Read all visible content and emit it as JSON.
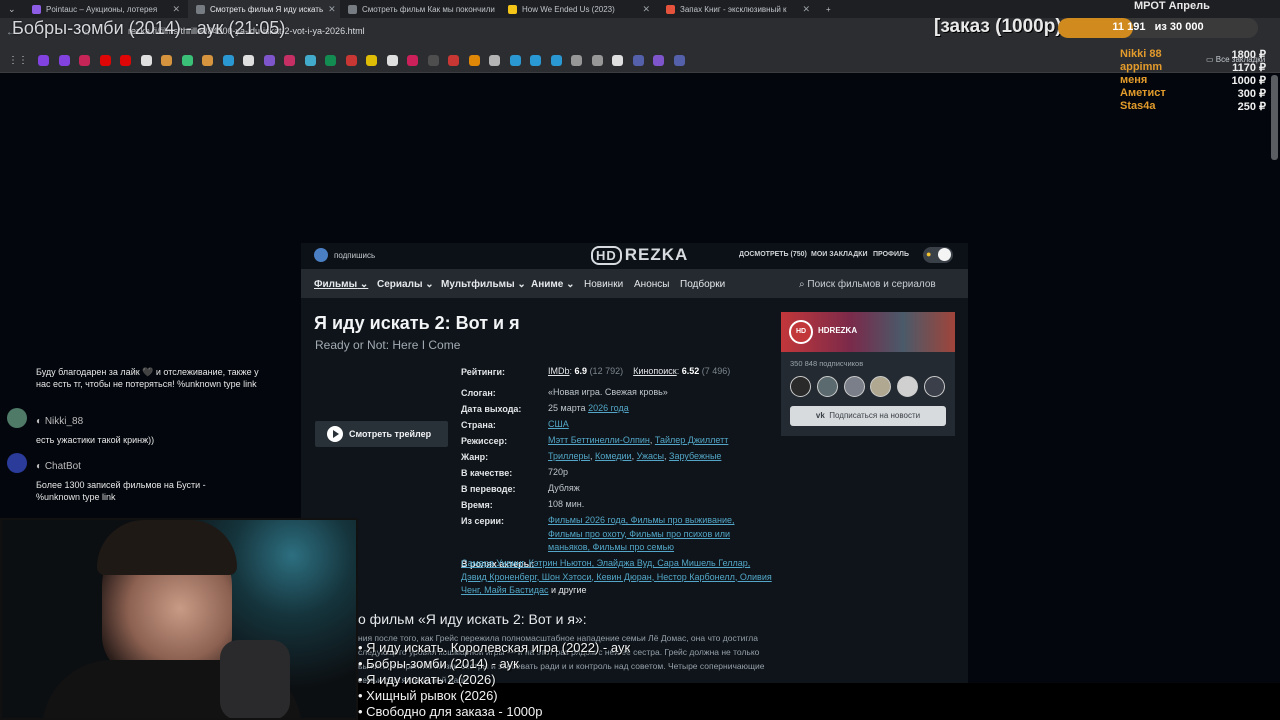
{
  "tabs": [
    {
      "label": "Pointauc – Аукционы, лотерея",
      "color": "#8e5de6"
    },
    {
      "label": "Смотреть фильм Я иду искать",
      "color": "#777c82"
    },
    {
      "label": "Смотреть фильм Как мы покончили",
      "color": "#777c82"
    },
    {
      "label": "How We Ended Us (2023)",
      "color": "#f5c518"
    },
    {
      "label": "Запах Книг - эксклюзивный к",
      "color": "#e5533d"
    }
  ],
  "new_tab": "+",
  "url": "rezka.fi/films/thriller/84300-ya-idu-iskat-2-vot-i-ya-2026.html",
  "overlay": {
    "stream_title": "Бобры-зомби (2014) - аук (21:05)",
    "order": "[заказ (1000р)",
    "goal_current": "11 191",
    "goal_total": "из 30 000",
    "goal_fraction": 0.373,
    "mrot": "МРОТ Апрель",
    "donors": [
      {
        "name": "Nikki 88",
        "amount": "1800 ₽"
      },
      {
        "name": "appimm",
        "amount": "1170 ₽"
      },
      {
        "name": "меня",
        "amount": "1000 ₽"
      },
      {
        "name": "Аметист",
        "amount": "300 ₽"
      },
      {
        "name": "Stas4a",
        "amount": "250 ₽"
      }
    ],
    "bookmarks_all": "Все закладки"
  },
  "chat": {
    "msg1": "Буду благодарен за лайк 🖤 и отслеживание, также у нас есть тг, чтобы не потеряться! %unknown type link",
    "user2": "Nikki_88",
    "msg2": "есть ужастики такой кринж))",
    "user3": "ChatBot",
    "msg3": "Более 1300 записей фильмов на Бусти - %unknown type link"
  },
  "site": {
    "subscribe": "подпишись",
    "logo_hd": "HD",
    "logo": "REZKA",
    "watch_later": "ДОСМОТРЕТЬ",
    "watch_later_count": "(750)",
    "bookmarks": "МОИ ЗАКЛАДКИ",
    "profile": "ПРОФИЛЬ",
    "nav": [
      "Фильмы",
      "Сериалы",
      "Мультфильмы",
      "Аниме",
      "Новинки",
      "Анонсы",
      "Подборки"
    ],
    "search_placeholder": "Поиск фильмов и сериалов",
    "title": "Я иду искать 2: Вот и я",
    "original_title": "Ready or Not: Here I Come",
    "trailer": "Смотреть трейлер",
    "labels": {
      "ratings": "Рейтинги:",
      "slogan": "Слоган:",
      "release": "Дата выхода:",
      "country": "Страна:",
      "director": "Режиссер:",
      "genre": "Жанр:",
      "quality": "В качестве:",
      "translation": "В переводе:",
      "time": "Время:",
      "series": "Из серии:",
      "actors": "В ролях актеры:"
    },
    "imdb": "IMDb",
    "imdb_score": "6.9",
    "imdb_votes": "(12 792)",
    "kp": "Кинопоиск",
    "kp_score": "6.52",
    "kp_votes": "(7 496)",
    "slogan": "«Новая игра. Свежая кровь»",
    "release_day": "25 марта",
    "release_year": "2026 года",
    "country": "США",
    "director1": "Мэтт Беттинелли-Олпин",
    "director2": "Тайлер Джиллетт",
    "genres": [
      "Триллеры",
      "Комедии",
      "Ужасы",
      "Зарубежные"
    ],
    "quality": "720p",
    "translation": "Дубляж",
    "time": "108 мин.",
    "series_text": "Фильмы 2026 года, Фильмы про выживание, Фильмы про охоту, Фильмы про психов или маньяков, Фильмы про семью",
    "actors_text": "Самара Уивинг, Кэтрин Ньютон, Элайджа Вуд, Сара Мишель Геллар, Дэвид Кроненберг, Шон Хэтоси, Кевин Дюран, Нестор Карбонелл, Оливия Ченг, Майя Бастидас",
    "actors_more": "и другие",
    "desc_head": "о фильм «Я иду искать 2: Вот и я»:",
    "desc": "ния после того, как Грейс пережила полномасштабное нападение семьи Лё Домас, она что достигла следующего уровня кошмарной игры — и на этот раз рядом с ней её сестра. Грейс должна не только выжить, сохранить жизнь сестры и завоевать ради и и контроль над советом. Четыре соперничающие семьи охотятся за ней ради",
    "vk_name": "HDREZKA",
    "vk_subs": "350 848 подписчиков",
    "vk_button": "Подписаться на новости"
  },
  "auction": [
    "• Я иду искать. Королевская игра (2022) - аук",
    "• Бобры-зомби (2014) - аук",
    "• Я иду искать 2 (2026)",
    "• Хищный рывок (2026)",
    "• Свободно для заказа - 1000р"
  ]
}
